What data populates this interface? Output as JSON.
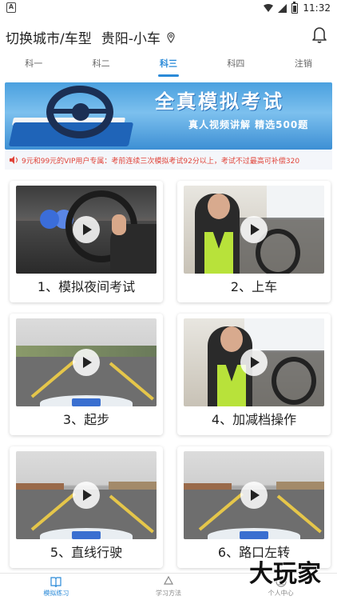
{
  "status_bar": {
    "time": "11:32"
  },
  "header": {
    "title": "切换城市/车型",
    "location": "贵阳-小车"
  },
  "tabs": [
    {
      "label": "科一",
      "active": false
    },
    {
      "label": "科二",
      "active": false
    },
    {
      "label": "科三",
      "active": true
    },
    {
      "label": "科四",
      "active": false
    },
    {
      "label": "注销",
      "active": false
    }
  ],
  "banner": {
    "title": "全真模拟考试",
    "subtitle": "真人视频讲解 精选500题"
  },
  "notice": {
    "text": "9元和99元的VIP用户专属：考前连续三次模拟考试92分以上，考试不过最高可补偿320"
  },
  "videos": [
    {
      "label": "1、模拟夜间考试"
    },
    {
      "label": "2、上车"
    },
    {
      "label": "3、起步"
    },
    {
      "label": "4、加减档操作"
    },
    {
      "label": "5、直线行驶"
    },
    {
      "label": "6、路口左转"
    }
  ],
  "bottom_nav": [
    {
      "label": "模拟练习",
      "active": true,
      "icon": "book-icon"
    },
    {
      "label": "学习方法",
      "active": false,
      "icon": "recycle-icon"
    },
    {
      "label": "个人中心",
      "active": false,
      "icon": "user-icon"
    }
  ],
  "watermark": {
    "text": "大玩家"
  },
  "colors": {
    "accent": "#2a8ad8",
    "notice": "#e0443a"
  }
}
